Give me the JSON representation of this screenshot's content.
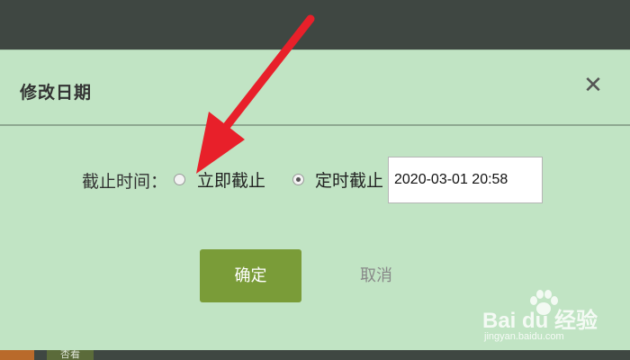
{
  "background": {
    "buttons": [
      "",
      "杏看"
    ]
  },
  "dialog": {
    "title": "修改日期",
    "close_symbol": "✕",
    "deadline_label": "截止时间：",
    "options": [
      {
        "label": "立即截止",
        "selected": false
      },
      {
        "label": "定时截止",
        "selected": true
      }
    ],
    "datetime_value": "2020-03-01 20:58",
    "confirm_label": "确定",
    "cancel_label": "取消"
  },
  "watermark": {
    "logo_text": "Bai du 经验",
    "url_text": "jingyan.baidu.com"
  },
  "colors": {
    "dialog_bg": "#c1e4c4",
    "confirm_bg": "#7a9c38",
    "annotation_arrow": "#e8202a",
    "page_bg": "#3f4742"
  }
}
